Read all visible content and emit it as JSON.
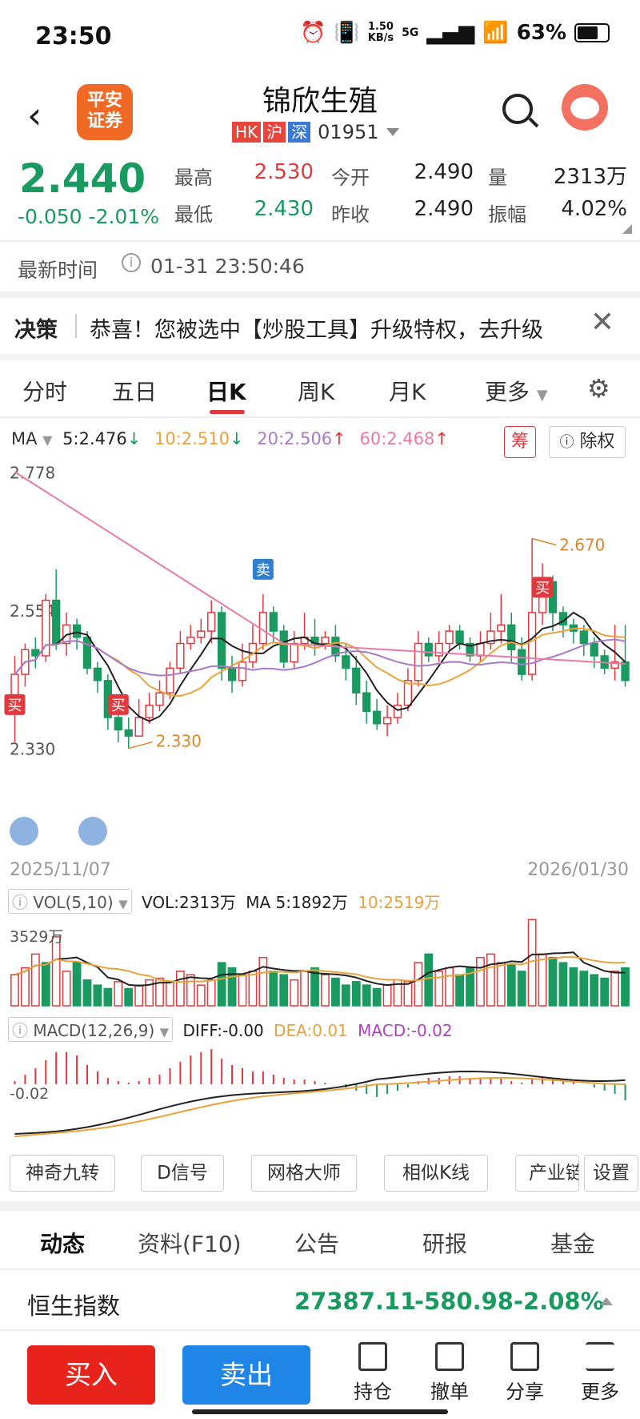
{
  "status_bar": {
    "time": "23:50",
    "net_speed_top": "1.50",
    "net_speed_bottom": "KB/s",
    "network": "5G",
    "battery": "63%"
  },
  "header": {
    "broker_logo": "平安\n证券",
    "stock_name": "锦欣生殖",
    "tags": [
      "HK",
      "沪",
      "深"
    ],
    "code": "01951"
  },
  "quote": {
    "price": "2.440",
    "change": "-0.050",
    "change_pct": "-2.01%",
    "high_label": "最高",
    "high": "2.530",
    "low_label": "最低",
    "low": "2.430",
    "open_label": "今开",
    "open": "2.490",
    "prev_close_label": "昨收",
    "prev_close": "2.490",
    "volume_label": "量",
    "volume": "2313万",
    "amplitude_label": "振幅",
    "amplitude": "4.02%"
  },
  "latest": {
    "label": "最新时间",
    "info_icon": "info-icon",
    "time": "01-31 23:50:46"
  },
  "notice": {
    "title": "决策",
    "text": "恭喜！您被选中【炒股工具】升级特权，去升级"
  },
  "period_tabs": [
    "分时",
    "五日",
    "日K",
    "周K",
    "月K",
    "更多"
  ],
  "active_period": "日K",
  "ma": {
    "label": "MA",
    "ma5": "5:2.476",
    "ma5_arrow": "↓",
    "ma10": "10:2.510",
    "ma10_arrow": "↓",
    "ma20": "20:2.506",
    "ma20_arrow": "↑",
    "ma60": "60:2.468",
    "ma60_arrow": "↑",
    "chip_button": "筹",
    "adjust_button": "除权"
  },
  "colors": {
    "up": "#e0393e",
    "down": "#1a9960",
    "ma5": "#222222",
    "ma10": "#e8a33a",
    "ma20": "#a87ac8",
    "ma60": "#e87aa8"
  },
  "chart_data": [
    {
      "type": "candlestick",
      "title": "",
      "y_labels": [
        "2.778",
        "2.554",
        "2.330"
      ],
      "ylim": [
        2.31,
        2.79
      ],
      "x_start": "2025/11/07",
      "x_end": "2026/01/30",
      "max_marker": "2.670",
      "min_marker": "2.330",
      "signals": [
        {
          "label": "买",
          "index": 0
        },
        {
          "label": "买",
          "index": 10
        },
        {
          "label": "卖",
          "index": 24
        },
        {
          "label": "买",
          "index": 51
        }
      ],
      "candles": [
        [
          2.4,
          2.45,
          2.34,
          2.48
        ],
        [
          2.45,
          2.49,
          2.43,
          2.5
        ],
        [
          2.49,
          2.48,
          2.46,
          2.51
        ],
        [
          2.48,
          2.57,
          2.47,
          2.58
        ],
        [
          2.57,
          2.5,
          2.49,
          2.62
        ],
        [
          2.5,
          2.53,
          2.48,
          2.55
        ],
        [
          2.53,
          2.51,
          2.49,
          2.54
        ],
        [
          2.51,
          2.46,
          2.45,
          2.52
        ],
        [
          2.46,
          2.44,
          2.42,
          2.47
        ],
        [
          2.44,
          2.38,
          2.36,
          2.45
        ],
        [
          2.38,
          2.36,
          2.34,
          2.4
        ],
        [
          2.36,
          2.35,
          2.33,
          2.38
        ],
        [
          2.35,
          2.38,
          2.35,
          2.41
        ],
        [
          2.38,
          2.4,
          2.37,
          2.42
        ],
        [
          2.4,
          2.42,
          2.39,
          2.44
        ],
        [
          2.42,
          2.46,
          2.41,
          2.47
        ],
        [
          2.46,
          2.5,
          2.45,
          2.52
        ],
        [
          2.5,
          2.51,
          2.49,
          2.53
        ],
        [
          2.51,
          2.52,
          2.5,
          2.54
        ],
        [
          2.52,
          2.55,
          2.5,
          2.57
        ],
        [
          2.55,
          2.46,
          2.44,
          2.56
        ],
        [
          2.46,
          2.44,
          2.42,
          2.48
        ],
        [
          2.44,
          2.47,
          2.43,
          2.5
        ],
        [
          2.47,
          2.5,
          2.46,
          2.53
        ],
        [
          2.5,
          2.55,
          2.49,
          2.58
        ],
        [
          2.55,
          2.52,
          2.5,
          2.56
        ],
        [
          2.52,
          2.47,
          2.46,
          2.53
        ],
        [
          2.47,
          2.5,
          2.46,
          2.52
        ],
        [
          2.5,
          2.51,
          2.49,
          2.55
        ],
        [
          2.51,
          2.5,
          2.48,
          2.54
        ],
        [
          2.5,
          2.51,
          2.49,
          2.52
        ],
        [
          2.51,
          2.48,
          2.47,
          2.53
        ],
        [
          2.48,
          2.46,
          2.44,
          2.5
        ],
        [
          2.46,
          2.42,
          2.4,
          2.48
        ],
        [
          2.42,
          2.39,
          2.37,
          2.44
        ],
        [
          2.39,
          2.37,
          2.36,
          2.41
        ],
        [
          2.37,
          2.38,
          2.35,
          2.4
        ],
        [
          2.38,
          2.4,
          2.37,
          2.42
        ],
        [
          2.4,
          2.44,
          2.39,
          2.46
        ],
        [
          2.44,
          2.5,
          2.43,
          2.52
        ],
        [
          2.5,
          2.48,
          2.47,
          2.51
        ],
        [
          2.48,
          2.5,
          2.47,
          2.52
        ],
        [
          2.5,
          2.52,
          2.49,
          2.53
        ],
        [
          2.52,
          2.5,
          2.49,
          2.53
        ],
        [
          2.5,
          2.48,
          2.47,
          2.51
        ],
        [
          2.48,
          2.5,
          2.47,
          2.52
        ],
        [
          2.5,
          2.52,
          2.49,
          2.55
        ],
        [
          2.52,
          2.53,
          2.5,
          2.58
        ],
        [
          2.53,
          2.49,
          2.47,
          2.55
        ],
        [
          2.49,
          2.45,
          2.44,
          2.51
        ],
        [
          2.45,
          2.55,
          2.44,
          2.67
        ],
        [
          2.55,
          2.6,
          2.53,
          2.63
        ],
        [
          2.6,
          2.55,
          2.52,
          2.61
        ],
        [
          2.55,
          2.53,
          2.51,
          2.56
        ],
        [
          2.53,
          2.52,
          2.5,
          2.54
        ],
        [
          2.52,
          2.5,
          2.48,
          2.53
        ],
        [
          2.5,
          2.48,
          2.46,
          2.51
        ],
        [
          2.48,
          2.46,
          2.45,
          2.49
        ],
        [
          2.46,
          2.47,
          2.44,
          2.53
        ],
        [
          2.47,
          2.44,
          2.43,
          2.53
        ]
      ]
    },
    {
      "type": "bar",
      "title": "VOL(5,10)",
      "labels": {
        "vol": "VOL:2313万",
        "ma5": "MA 5:1892万",
        "ma10": "10:2519万"
      },
      "y_label": "3529万",
      "values": [
        18,
        22,
        30,
        25,
        40,
        20,
        25,
        15,
        12,
        10,
        14,
        10,
        12,
        15,
        16,
        14,
        20,
        18,
        12,
        15,
        25,
        22,
        18,
        20,
        28,
        20,
        18,
        15,
        20,
        22,
        18,
        16,
        12,
        14,
        12,
        10,
        12,
        15,
        14,
        25,
        30,
        20,
        22,
        18,
        22,
        28,
        30,
        25,
        24,
        20,
        50,
        30,
        28,
        25,
        22,
        20,
        18,
        16,
        20,
        22
      ],
      "up_flags": [
        1,
        1,
        1,
        0,
        1,
        1,
        0,
        0,
        0,
        0,
        1,
        0,
        1,
        1,
        1,
        1,
        1,
        1,
        1,
        1,
        0,
        0,
        1,
        1,
        1,
        0,
        0,
        1,
        1,
        0,
        1,
        0,
        0,
        0,
        0,
        0,
        1,
        1,
        1,
        1,
        0,
        1,
        1,
        0,
        0,
        1,
        1,
        1,
        0,
        0,
        1,
        1,
        0,
        0,
        0,
        0,
        0,
        0,
        1,
        0
      ]
    },
    {
      "type": "bar",
      "title": "MACD(12,26,9)",
      "labels": {
        "diff": "DIFF:-0.00",
        "dea": "DEA:0.01",
        "macd": "MACD:-0.02"
      },
      "y_label": "-0.02",
      "values": [
        0.002,
        0.006,
        0.01,
        0.015,
        0.02,
        0.02,
        0.018,
        0.012,
        0.008,
        0.004,
        0.002,
        0.001,
        0.002,
        0.004,
        0.006,
        0.01,
        0.014,
        0.018,
        0.02,
        0.022,
        0.016,
        0.012,
        0.01,
        0.008,
        0.008,
        0.006,
        0.004,
        0.003,
        0.003,
        0.002,
        0.001,
        0.0,
        -0.002,
        -0.004,
        -0.006,
        -0.008,
        -0.006,
        -0.004,
        -0.002,
        0.002,
        0.004,
        0.004,
        0.005,
        0.005,
        0.004,
        0.004,
        0.004,
        0.004,
        0.002,
        0.001,
        0.004,
        0.005,
        0.004,
        0.003,
        0.002,
        0.0,
        -0.002,
        -0.004,
        -0.006,
        -0.01
      ]
    }
  ],
  "tools": [
    "神奇九转",
    "D信号",
    "网格大师",
    "相似K线",
    "产业链",
    "设置"
  ],
  "info_tabs": [
    "动态",
    "资料(F10)",
    "公告",
    "研报",
    "基金"
  ],
  "index": {
    "name": "恒生指数",
    "value": "27387.11",
    "change": "-580.98",
    "pct": "-2.08%"
  },
  "bottom_bar": {
    "buy": "买入",
    "sell": "卖出",
    "items": [
      "持仓",
      "撤单",
      "分享",
      "更多"
    ]
  }
}
